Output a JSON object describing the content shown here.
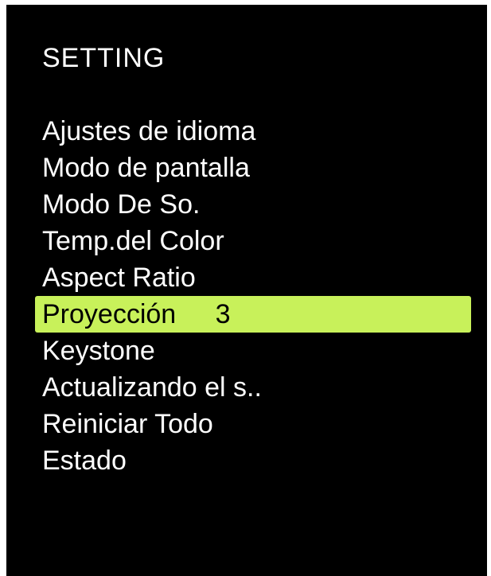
{
  "osd": {
    "title": "SETTING",
    "highlight_color": "#c8f15a",
    "items": [
      {
        "label": "Ajustes de idioma",
        "value": ""
      },
      {
        "label": "Modo de pantalla",
        "value": ""
      },
      {
        "label": "Modo De So.",
        "value": ""
      },
      {
        "label": "Temp.del Color",
        "value": ""
      },
      {
        "label": "Aspect Ratio",
        "value": ""
      },
      {
        "label": "Proyección",
        "value": "3",
        "selected": true
      },
      {
        "label": "Keystone",
        "value": ""
      },
      {
        "label": "Actualizando el s..",
        "value": ""
      },
      {
        "label": "Reiniciar Todo",
        "value": ""
      },
      {
        "label": "Estado",
        "value": ""
      }
    ]
  }
}
